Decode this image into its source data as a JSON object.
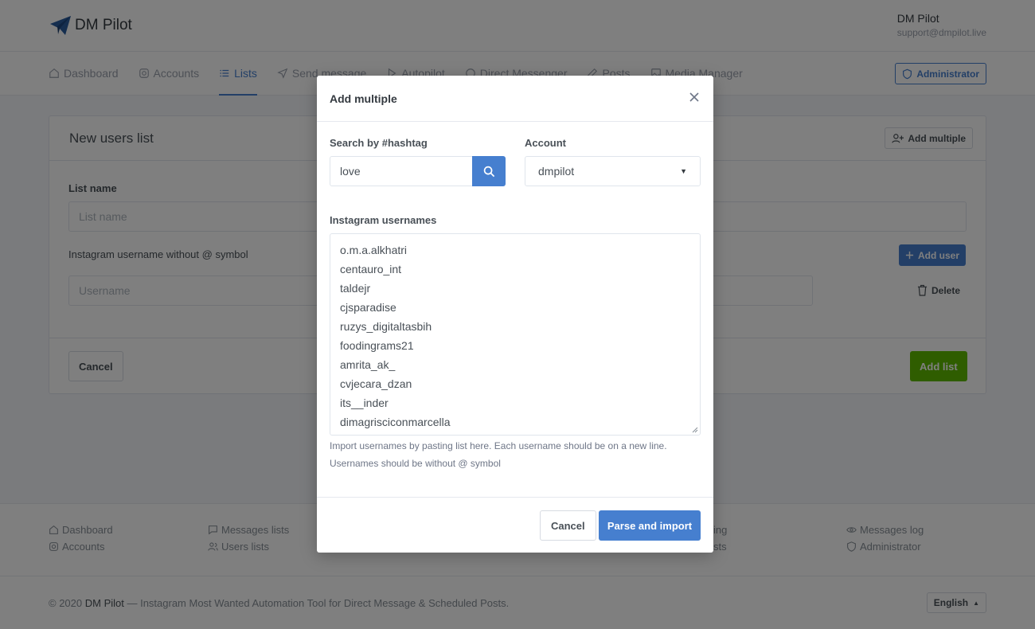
{
  "brand": {
    "name": "DM Pilot"
  },
  "user": {
    "name": "DM Pilot",
    "email": "support@dmpilot.live"
  },
  "nav": {
    "items": [
      {
        "label": "Dashboard",
        "icon": "home-icon"
      },
      {
        "label": "Accounts",
        "icon": "instagram-icon"
      },
      {
        "label": "Lists",
        "icon": "list-icon"
      },
      {
        "label": "Send message",
        "icon": "send-icon"
      },
      {
        "label": "Autopilot",
        "icon": "play-icon"
      },
      {
        "label": "Direct Messenger",
        "icon": "circle-icon"
      },
      {
        "label": "Posts",
        "icon": "pen-icon"
      },
      {
        "label": "Media Manager",
        "icon": "image-icon"
      }
    ],
    "admin_label": "Administrator"
  },
  "card": {
    "title": "New users list",
    "add_multiple_label": "Add multiple",
    "list_name_label": "List name",
    "list_name_placeholder": "List name",
    "username_label": "Instagram username without @ symbol",
    "username_placeholder": "Username",
    "add_user_label": "Add user",
    "delete_label": "Delete",
    "cancel_label": "Cancel",
    "add_list_label": "Add list"
  },
  "footer": {
    "col1": [
      "Dashboard",
      "Accounts"
    ],
    "col2": [
      "Messages lists",
      "Users lists"
    ],
    "col3": [
      "ing",
      "sts"
    ],
    "col4": [
      "Messages log",
      "Administrator"
    ],
    "copyright_prefix": "© 2020 ",
    "copyright_brand": "DM Pilot",
    "copyright_suffix": " — Instagram Most Wanted Automation Tool for Direct Message & Scheduled Posts.",
    "language": "English"
  },
  "modal": {
    "title": "Add multiple",
    "hashtag_label": "Search by #hashtag",
    "hashtag_value": "love",
    "account_label": "Account",
    "account_value": "dmpilot",
    "usernames_label": "Instagram usernames",
    "usernames": [
      "o.m.a.alkhatri",
      "centauro_int",
      "taldejr",
      "cjsparadise",
      "ruzys_digitaltasbih",
      "foodingrams21",
      "amrita_ak_",
      "cvjecara_dzan",
      "its__inder",
      "dimagrisciconmarcella"
    ],
    "help_line1": "Import usernames by pasting list here. Each username should be on a new line.",
    "help_line2": "Usernames should be without @ symbol",
    "cancel_label": "Cancel",
    "parse_label": "Parse and import"
  },
  "colors": {
    "primary": "#467fcf",
    "success": "#5eba00"
  }
}
